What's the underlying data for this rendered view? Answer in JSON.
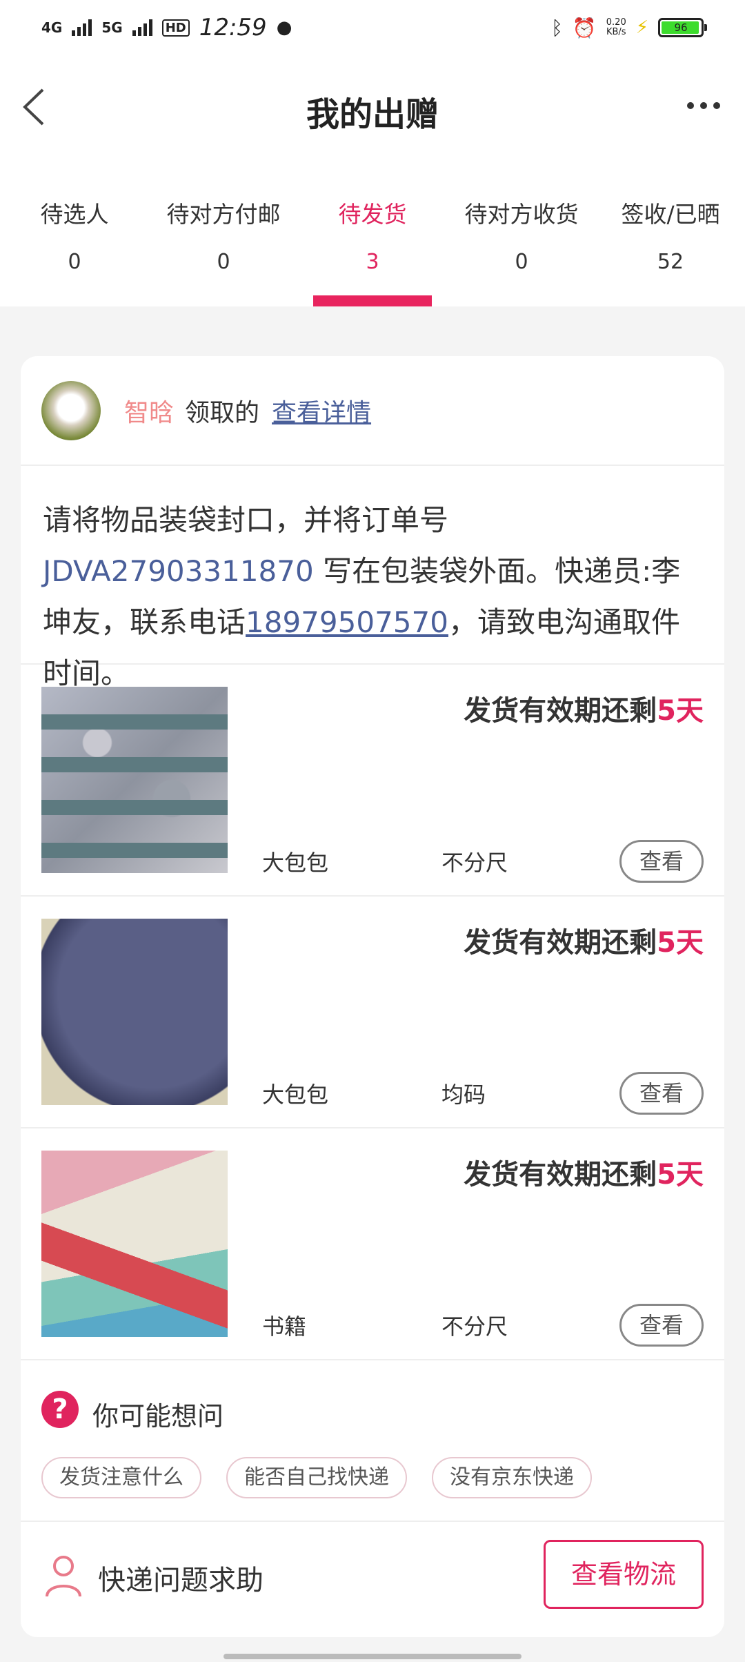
{
  "status_bar": {
    "signal1": "4G",
    "signal2": "5G",
    "hd": "HD",
    "time": "12:59",
    "net_speed": "0.20",
    "net_unit": "KB/s",
    "battery": "96"
  },
  "header": {
    "title": "我的出赠"
  },
  "tabs": [
    {
      "label": "待选人",
      "count": "0"
    },
    {
      "label": "待对方付邮",
      "count": "0"
    },
    {
      "label": "待发货",
      "count": "3"
    },
    {
      "label": "待对方收货",
      "count": "0"
    },
    {
      "label": "签收/已晒",
      "count": "52"
    }
  ],
  "active_tab": 2,
  "order": {
    "user_name": "智晗",
    "user_action": "领取的",
    "detail_link": "查看详情",
    "notice_pre": "请将物品装袋封口，并将订单号 ",
    "order_no": "JDVA27903311870",
    "notice_mid": " 写在包装袋外面。快递员:李坤友，联系电话",
    "phone": "18979507570",
    "notice_post": "，请致电沟通取件时间。"
  },
  "items": [
    {
      "deadline_prefix": "发货有效期还剩",
      "deadline_days": "5天",
      "name": "大包包",
      "size": "不分尺",
      "view_label": "查看"
    },
    {
      "deadline_prefix": "发货有效期还剩",
      "deadline_days": "5天",
      "name": "大包包",
      "size": "均码",
      "view_label": "查看"
    },
    {
      "deadline_prefix": "发货有效期还剩",
      "deadline_days": "5天",
      "name": "书籍",
      "size": "不分尺",
      "view_label": "查看"
    }
  ],
  "faq": {
    "title": "你可能想问",
    "chips": [
      "发货注意什么",
      "能否自己找快递",
      "没有京东快递"
    ]
  },
  "help": {
    "label": "快递问题求助",
    "track_button": "查看物流"
  }
}
